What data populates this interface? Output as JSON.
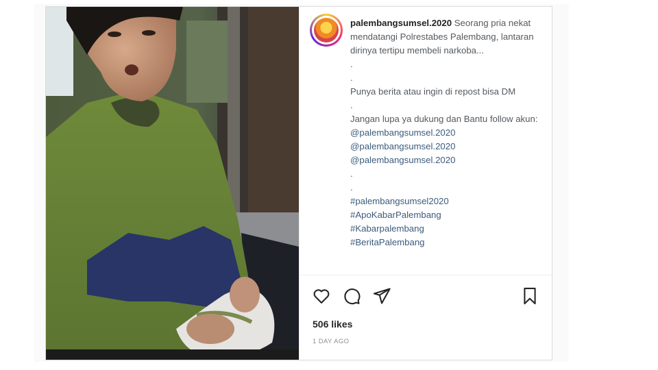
{
  "post": {
    "username": "palembangsumsel.2020",
    "caption_intro": "Seorang pria nekat mendatangi Polrestabes Palembang, lantaran dirinya tertipu membeli narkoba...",
    "dot": ".",
    "repost_text": "Punya berita atau ingin di repost bisa DM",
    "follow_text": "Jangan lupa ya dukung dan Bantu follow akun:",
    "mentions": [
      "@palembangsumsel.2020",
      "@palembangsumsel.2020",
      "@palembangsumsel.2020"
    ],
    "hashtags": [
      "#palembangsumsel2020",
      "#ApoKabarPalembang",
      "#Kabarpalembang",
      "#BeritaPalembang"
    ],
    "likes": "506 likes",
    "time": "1 DAY AGO"
  },
  "icons": {
    "like": "heart-icon",
    "comment": "comment-icon",
    "share": "send-icon",
    "save": "bookmark-icon"
  }
}
